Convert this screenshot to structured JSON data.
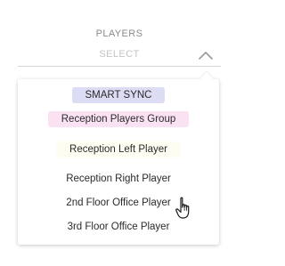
{
  "field": {
    "label": "PLAYERS",
    "placeholder": "SELECT"
  },
  "icons": {
    "chevron": "chevron-up-icon",
    "cursor": "hand-pointer-cursor"
  },
  "options": [
    {
      "label": "SMART SYNC",
      "highlight": "#dcdcf4"
    },
    {
      "label": "Reception Players Group",
      "highlight": "#fbe2f3"
    },
    {
      "label": "Reception Left Player",
      "highlight": "#fdfdf2"
    },
    {
      "label": "Reception Right Player",
      "highlight": ""
    },
    {
      "label": "2nd Floor Office Player",
      "highlight": ""
    },
    {
      "label": "3rd Floor Office Player",
      "highlight": ""
    }
  ]
}
